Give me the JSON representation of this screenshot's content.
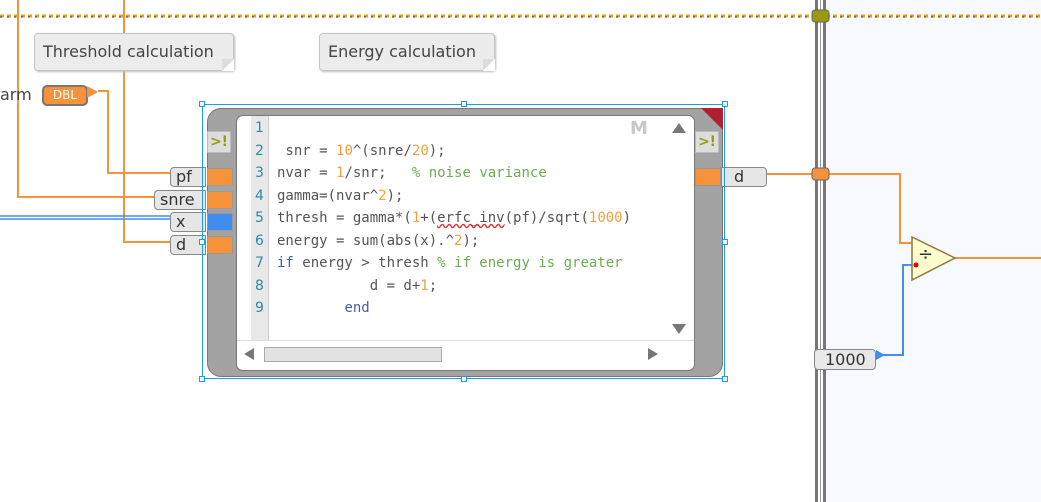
{
  "comments": {
    "threshold": "Threshold calculation",
    "energy": "Energy calculation"
  },
  "left_label": "arm",
  "dbl_constant": "DBL",
  "inputs": [
    {
      "label": "pf",
      "color": "#f5923a"
    },
    {
      "label": "snre",
      "color": "#f5923a"
    },
    {
      "label": "x",
      "color": "#3f8ef0"
    },
    {
      "label": "d",
      "color": "#f5923a"
    }
  ],
  "output": {
    "label": "d",
    "color": "#f5923a"
  },
  "node_badge": "M",
  "constant_1000": "1000",
  "divide_symbol": "÷",
  "line_numbers": [
    "1",
    "2",
    "3",
    "4",
    "5",
    "6",
    "7",
    "8",
    "9"
  ],
  "code": [
    [],
    [
      {
        "t": " snr = ",
        "c": ""
      },
      {
        "t": "10",
        "c": "num"
      },
      {
        "t": "^(snre/",
        "c": ""
      },
      {
        "t": "20",
        "c": "num"
      },
      {
        "t": ");",
        "c": ""
      }
    ],
    [
      {
        "t": "nvar = ",
        "c": ""
      },
      {
        "t": "1",
        "c": "num"
      },
      {
        "t": "/snr;   ",
        "c": ""
      },
      {
        "t": "% noise variance",
        "c": "cmt"
      }
    ],
    [
      {
        "t": "gamma=(nvar^",
        "c": ""
      },
      {
        "t": "2",
        "c": "num"
      },
      {
        "t": ");",
        "c": ""
      }
    ],
    [
      {
        "t": "thresh = gamma*(",
        "c": ""
      },
      {
        "t": "1",
        "c": "num"
      },
      {
        "t": "+(",
        "c": ""
      },
      {
        "t": "erfc_inv",
        "c": "err"
      },
      {
        "t": "(pf)/sqrt(",
        "c": ""
      },
      {
        "t": "1000",
        "c": "num"
      },
      {
        "t": ")",
        "c": ""
      }
    ],
    [
      {
        "t": "energy = sum(abs(x).^",
        "c": ""
      },
      {
        "t": "2",
        "c": "num"
      },
      {
        "t": ");",
        "c": ""
      }
    ],
    [
      {
        "t": "if",
        "c": "kw"
      },
      {
        "t": " energy > thresh ",
        "c": ""
      },
      {
        "t": "% if energy is greater",
        "c": "cmt"
      }
    ],
    [
      {
        "t": "           d = d+",
        "c": ""
      },
      {
        "t": "1",
        "c": "num"
      },
      {
        "t": ";",
        "c": ""
      }
    ],
    [
      {
        "t": "        ",
        "c": ""
      },
      {
        "t": "end",
        "c": "kw"
      }
    ]
  ],
  "colors": {
    "orange_wire": "#f5923a",
    "blue_wire": "#3f8ef0",
    "selection": "#1aa0e0",
    "divide_fill": "#fdfccf"
  }
}
